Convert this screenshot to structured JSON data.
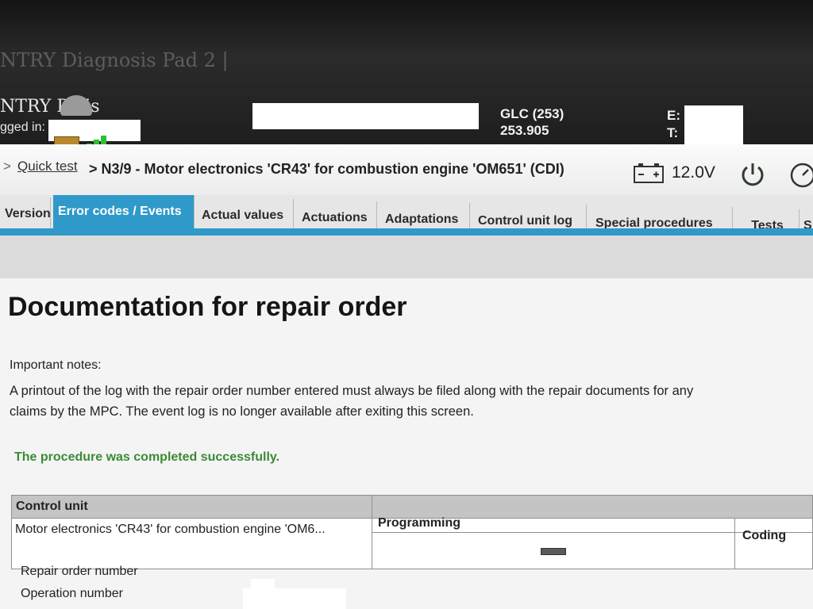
{
  "app": {
    "title": "NTRY Diagnosis Pad 2 |",
    "subtitle": "NTRY D  sis",
    "logged_in_label": "gged in:"
  },
  "vehicle": {
    "model": "GLC (253)",
    "code": "253.905",
    "e_label": "E:",
    "t_label": "T:"
  },
  "breadcrumb": {
    "separator": ">",
    "link": "Quick test",
    "current": "> N3/9 - Motor electronics 'CR43' for combustion engine 'OM651' (CDI)"
  },
  "status": {
    "voltage": "12.0V",
    "battery_icon": "battery-icon",
    "power_icon": "power-icon",
    "gauge_icon": "gauge-icon"
  },
  "tabs": [
    {
      "label": "Version",
      "active": false
    },
    {
      "label": "Error codes / Events",
      "active": true
    },
    {
      "label": "Actual values",
      "active": false
    },
    {
      "label": "Actuations",
      "active": false
    },
    {
      "label": "Adaptations",
      "active": false
    },
    {
      "label": "Control unit log",
      "active": false
    },
    {
      "label": "Special procedures",
      "active": false
    },
    {
      "label": "Tests",
      "active": false
    },
    {
      "label": "S",
      "active": false
    }
  ],
  "main": {
    "title": "Documentation for repair order",
    "notes_label": "Important notes:",
    "notes_lines": [
      "A printout of the log with the repair order number entered must always be filed along with the repair documents for any",
      "claims by the MPC. The event log is no longer available after exiting this screen."
    ],
    "success": "The procedure was completed successfully."
  },
  "control_table": {
    "headers": {
      "control_unit": "Control unit",
      "programming": "Programming",
      "coding": "Coding"
    },
    "rows": [
      {
        "control_unit": "Motor electronics 'CR43' for combustion engine 'OM6...",
        "programming": "",
        "coding": ""
      }
    ]
  },
  "fields": {
    "repair_order_label": "Repair order number",
    "operation_label": "Operation number"
  },
  "colors": {
    "accent": "#2f99c9",
    "success": "#3b8a37"
  }
}
